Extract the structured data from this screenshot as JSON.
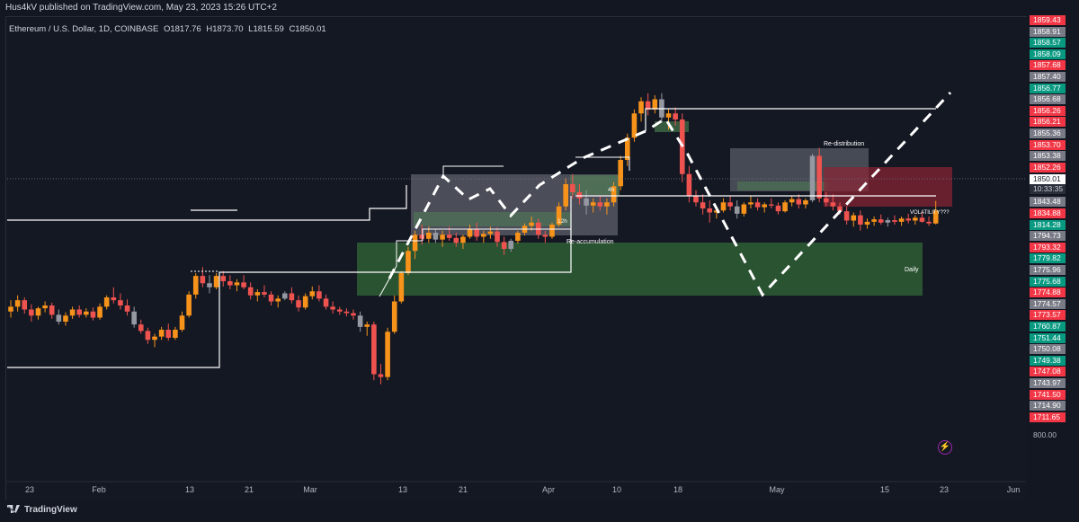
{
  "header": {
    "publisher": "Hus4kV published on TradingView.com, May 23, 2023 15:26 UTC+2",
    "symbol": "Ethereum / U.S. Dollar, 1D, COINBASE",
    "open": "O1817.76",
    "high": "H1873.70",
    "low": "L1815.59",
    "close": "C1850.01"
  },
  "footer": {
    "brand": "TradingView"
  },
  "annotations": {
    "re_distribution": "Re-distribution",
    "re_accumulation": "Re-accumulation",
    "volatility": "VOLATILITY???",
    "daily": "Daily",
    "h4": "4h",
    "h12": "12h"
  },
  "colors": {
    "background": "#131722",
    "bull": "#f7931a",
    "bear": "#ef5350",
    "neutral": "#9598a1",
    "green_zone": "#2e5e35",
    "red_zone": "#8b2233",
    "gray_zone": "#787b86",
    "tag_green": "#089981",
    "tag_red": "#f23645",
    "tag_gray": "#787b86",
    "last_price_bg": "#ffffff"
  },
  "price_axis": {
    "current_price": "1850.01",
    "countdown": "10:33:35",
    "bottom_label": "800.00",
    "tags": [
      {
        "label": "1859.43",
        "color": "#f23645"
      },
      {
        "label": "1858.91",
        "color": "#787b86"
      },
      {
        "label": "1858.57",
        "color": "#089981"
      },
      {
        "label": "1858.09",
        "color": "#089981"
      },
      {
        "label": "1857.68",
        "color": "#f23645"
      },
      {
        "label": "1857.40",
        "color": "#787b86"
      },
      {
        "label": "1856.77",
        "color": "#089981"
      },
      {
        "label": "1856.68",
        "color": "#787b86"
      },
      {
        "label": "1856.26",
        "color": "#f23645"
      },
      {
        "label": "1856.21",
        "color": "#f23645"
      },
      {
        "label": "1855.36",
        "color": "#787b86"
      },
      {
        "label": "1853.70",
        "color": "#f23645"
      },
      {
        "label": "1853.38",
        "color": "#787b86"
      },
      {
        "label": "1852.26",
        "color": "#f23645"
      },
      {
        "label": "1843.48",
        "color": "#787b86"
      },
      {
        "label": "1834.88",
        "color": "#f23645"
      },
      {
        "label": "1814.28",
        "color": "#089981"
      },
      {
        "label": "1794.73",
        "color": "#787b86"
      },
      {
        "label": "1793.32",
        "color": "#f23645"
      },
      {
        "label": "1779.82",
        "color": "#089981"
      },
      {
        "label": "1775.96",
        "color": "#787b86"
      },
      {
        "label": "1775.68",
        "color": "#089981"
      },
      {
        "label": "1774.88",
        "color": "#f23645"
      },
      {
        "label": "1774.57",
        "color": "#787b86"
      },
      {
        "label": "1773.57",
        "color": "#f23645"
      },
      {
        "label": "1760.87",
        "color": "#089981"
      },
      {
        "label": "1751.44",
        "color": "#089981"
      },
      {
        "label": "1750.08",
        "color": "#787b86"
      },
      {
        "label": "1749.38",
        "color": "#089981"
      },
      {
        "label": "1747.08",
        "color": "#f23645"
      },
      {
        "label": "1743.97",
        "color": "#787b86"
      },
      {
        "label": "1741.50",
        "color": "#f23645"
      },
      {
        "label": "1714.90",
        "color": "#787b86"
      },
      {
        "label": "1711.65",
        "color": "#f23645"
      }
    ]
  },
  "time_axis": {
    "labels": [
      "23",
      "Feb",
      "13",
      "21",
      "Mar",
      "13",
      "21",
      "Apr",
      "10",
      "18",
      "May",
      "15",
      "23",
      "Jun"
    ]
  },
  "chart_data": {
    "type": "candlestick",
    "title": "Ethereum / U.S. Dollar, 1D, COINBASE",
    "x_start": "2023-01-20",
    "x_end": "2023-06-02",
    "last_ohlc": {
      "open": 1817.76,
      "high": 1873.7,
      "low": 1815.59,
      "close": 1850.01
    },
    "ohlc": [
      [
        1600,
        1628,
        1585,
        1612
      ],
      [
        1612,
        1640,
        1600,
        1628
      ],
      [
        1628,
        1635,
        1595,
        1605
      ],
      [
        1605,
        1618,
        1575,
        1590
      ],
      [
        1590,
        1612,
        1580,
        1608
      ],
      [
        1608,
        1625,
        1598,
        1615
      ],
      [
        1615,
        1622,
        1582,
        1592
      ],
      [
        1592,
        1605,
        1568,
        1575
      ],
      [
        1575,
        1598,
        1565,
        1590
      ],
      [
        1590,
        1612,
        1582,
        1605
      ],
      [
        1605,
        1615,
        1585,
        1592
      ],
      [
        1592,
        1608,
        1585,
        1600
      ],
      [
        1600,
        1610,
        1578,
        1585
      ],
      [
        1585,
        1620,
        1580,
        1612
      ],
      [
        1612,
        1640,
        1605,
        1635
      ],
      [
        1635,
        1660,
        1620,
        1628
      ],
      [
        1628,
        1645,
        1605,
        1615
      ],
      [
        1615,
        1630,
        1590,
        1600
      ],
      [
        1600,
        1612,
        1560,
        1568
      ],
      [
        1568,
        1580,
        1545,
        1552
      ],
      [
        1552,
        1560,
        1520,
        1530
      ],
      [
        1530,
        1545,
        1512,
        1538
      ],
      [
        1538,
        1562,
        1530,
        1555
      ],
      [
        1555,
        1570,
        1528,
        1535
      ],
      [
        1535,
        1562,
        1530,
        1555
      ],
      [
        1555,
        1600,
        1550,
        1590
      ],
      [
        1590,
        1650,
        1585,
        1642
      ],
      [
        1642,
        1695,
        1632,
        1688
      ],
      [
        1688,
        1710,
        1660,
        1670
      ],
      [
        1670,
        1690,
        1645,
        1660
      ],
      [
        1660,
        1695,
        1655,
        1688
      ],
      [
        1688,
        1700,
        1662,
        1675
      ],
      [
        1675,
        1690,
        1655,
        1665
      ],
      [
        1665,
        1680,
        1650,
        1672
      ],
      [
        1672,
        1690,
        1655,
        1660
      ],
      [
        1660,
        1672,
        1630,
        1640
      ],
      [
        1640,
        1655,
        1625,
        1648
      ],
      [
        1648,
        1665,
        1635,
        1642
      ],
      [
        1642,
        1650,
        1615,
        1625
      ],
      [
        1625,
        1640,
        1610,
        1632
      ],
      [
        1632,
        1650,
        1628,
        1645
      ],
      [
        1645,
        1660,
        1620,
        1628
      ],
      [
        1628,
        1640,
        1600,
        1610
      ],
      [
        1610,
        1645,
        1605,
        1638
      ],
      [
        1638,
        1662,
        1630,
        1650
      ],
      [
        1650,
        1665,
        1625,
        1632
      ],
      [
        1632,
        1642,
        1605,
        1612
      ],
      [
        1612,
        1625,
        1595,
        1605
      ],
      [
        1605,
        1612,
        1592,
        1600
      ],
      [
        1600,
        1608,
        1588,
        1596
      ],
      [
        1596,
        1605,
        1580,
        1590
      ],
      [
        1590,
        1600,
        1550,
        1562
      ],
      [
        1562,
        1575,
        1540,
        1568
      ],
      [
        1568,
        1575,
        1430,
        1445
      ],
      [
        1445,
        1470,
        1420,
        1438
      ],
      [
        1438,
        1560,
        1430,
        1550
      ],
      [
        1550,
        1640,
        1545,
        1625
      ],
      [
        1625,
        1700,
        1620,
        1695
      ],
      [
        1695,
        1760,
        1690,
        1750
      ],
      [
        1750,
        1800,
        1730,
        1790
      ],
      [
        1790,
        1815,
        1765,
        1780
      ],
      [
        1780,
        1810,
        1770,
        1795
      ],
      [
        1795,
        1805,
        1770,
        1778
      ],
      [
        1778,
        1800,
        1760,
        1790
      ],
      [
        1790,
        1810,
        1775,
        1782
      ],
      [
        1782,
        1795,
        1760,
        1770
      ],
      [
        1770,
        1790,
        1755,
        1785
      ],
      [
        1785,
        1815,
        1780,
        1805
      ],
      [
        1805,
        1820,
        1775,
        1785
      ],
      [
        1785,
        1800,
        1770,
        1792
      ],
      [
        1792,
        1810,
        1780,
        1798
      ],
      [
        1798,
        1808,
        1760,
        1772
      ],
      [
        1772,
        1785,
        1740,
        1755
      ],
      [
        1755,
        1780,
        1748,
        1775
      ],
      [
        1775,
        1800,
        1768,
        1795
      ],
      [
        1795,
        1818,
        1788,
        1812
      ],
      [
        1812,
        1835,
        1800,
        1820
      ],
      [
        1820,
        1830,
        1780,
        1790
      ],
      [
        1790,
        1800,
        1770,
        1785
      ],
      [
        1785,
        1820,
        1780,
        1815
      ],
      [
        1815,
        1870,
        1810,
        1860
      ],
      [
        1860,
        1930,
        1850,
        1915
      ],
      [
        1915,
        1940,
        1880,
        1895
      ],
      [
        1895,
        1915,
        1865,
        1880
      ],
      [
        1880,
        1900,
        1840,
        1862
      ],
      [
        1862,
        1880,
        1845,
        1870
      ],
      [
        1870,
        1885,
        1850,
        1860
      ],
      [
        1860,
        1880,
        1840,
        1870
      ],
      [
        1870,
        1920,
        1860,
        1910
      ],
      [
        1910,
        1985,
        1900,
        1975
      ],
      [
        1975,
        2040,
        1960,
        2030
      ],
      [
        2030,
        2100,
        2020,
        2090
      ],
      [
        2090,
        2130,
        2070,
        2120
      ],
      [
        2120,
        2140,
        2085,
        2100
      ],
      [
        2100,
        2135,
        2090,
        2125
      ],
      [
        2125,
        2140,
        2070,
        2080
      ],
      [
        2080,
        2100,
        2050,
        2090
      ],
      [
        2090,
        2105,
        2060,
        2075
      ],
      [
        2075,
        2090,
        1920,
        1940
      ],
      [
        1940,
        1960,
        1870,
        1885
      ],
      [
        1885,
        1900,
        1860,
        1870
      ],
      [
        1870,
        1890,
        1840,
        1855
      ],
      [
        1855,
        1875,
        1820,
        1845
      ],
      [
        1845,
        1860,
        1830,
        1850
      ],
      [
        1850,
        1880,
        1845,
        1870
      ],
      [
        1870,
        1885,
        1850,
        1860
      ],
      [
        1860,
        1875,
        1830,
        1842
      ],
      [
        1842,
        1870,
        1835,
        1865
      ],
      [
        1865,
        1885,
        1855,
        1870
      ],
      [
        1870,
        1880,
        1850,
        1858
      ],
      [
        1858,
        1870,
        1845,
        1865
      ],
      [
        1865,
        1880,
        1855,
        1862
      ],
      [
        1862,
        1870,
        1840,
        1848
      ],
      [
        1848,
        1875,
        1845,
        1870
      ],
      [
        1870,
        1885,
        1860,
        1878
      ],
      [
        1878,
        1890,
        1855,
        1865
      ],
      [
        1865,
        1880,
        1855,
        1875
      ],
      [
        1875,
        1990,
        1870,
        1985
      ],
      [
        1985,
        2005,
        1870,
        1880
      ],
      [
        1880,
        1895,
        1860,
        1870
      ],
      [
        1870,
        1890,
        1850,
        1860
      ],
      [
        1860,
        1870,
        1840,
        1848
      ],
      [
        1848,
        1860,
        1815,
        1825
      ],
      [
        1825,
        1845,
        1810,
        1838
      ],
      [
        1838,
        1850,
        1800,
        1815
      ],
      [
        1815,
        1830,
        1805,
        1822
      ],
      [
        1822,
        1835,
        1812,
        1828
      ],
      [
        1828,
        1840,
        1815,
        1820
      ],
      [
        1820,
        1832,
        1810,
        1826
      ],
      [
        1826,
        1838,
        1815,
        1822
      ],
      [
        1822,
        1835,
        1812,
        1830
      ],
      [
        1830,
        1842,
        1818,
        1825
      ],
      [
        1825,
        1838,
        1815,
        1832
      ],
      [
        1832,
        1845,
        1820,
        1822
      ],
      [
        1822,
        1835,
        1812,
        1818
      ],
      [
        1817.76,
        1873.7,
        1815.59,
        1850.01
      ]
    ]
  }
}
